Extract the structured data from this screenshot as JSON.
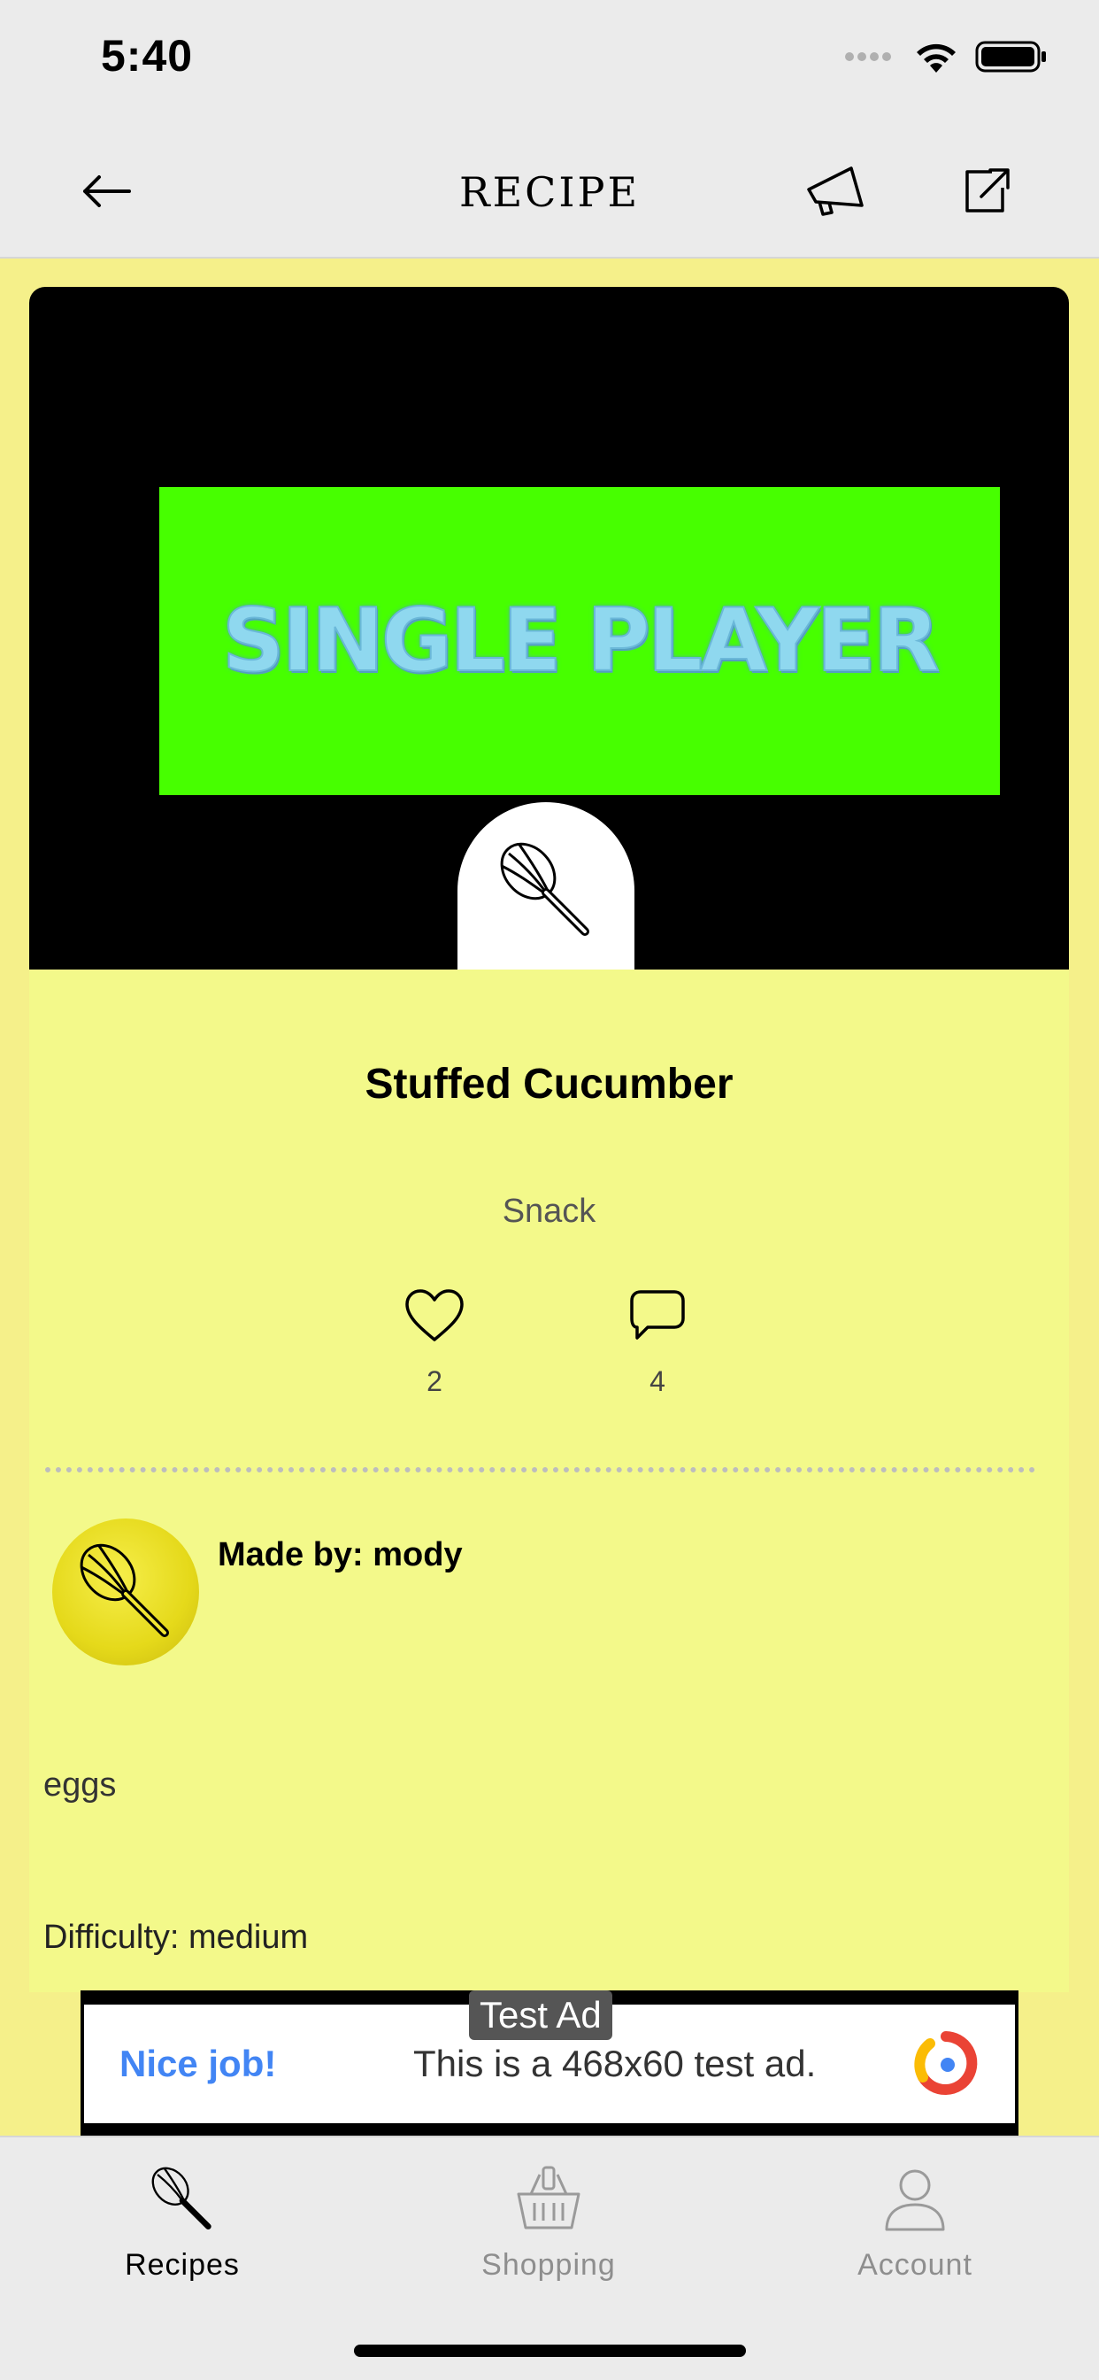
{
  "status_bar": {
    "time": "5:40"
  },
  "nav": {
    "title": "RECIPE",
    "back_icon": "arrow-left-icon",
    "promote_icon": "megaphone-icon",
    "share_icon": "share-icon"
  },
  "media": {
    "banner_text": "SINGLE PLAYER",
    "overlay_icon": "whisk-icon"
  },
  "recipe": {
    "name": "Stuffed Cucumber",
    "category": "Snack",
    "likes": "2",
    "comments": "4",
    "author_label": "Made by: mody",
    "ingredients": "eggs",
    "difficulty": "Difficulty: medium"
  },
  "ad": {
    "badge": "Test Ad",
    "headline": "Nice job!",
    "body": "This is a 468x60 test ad."
  },
  "tabs": [
    {
      "label": "Recipes",
      "icon": "whisk-icon",
      "active": true
    },
    {
      "label": "Shopping",
      "icon": "basket-icon",
      "active": false
    },
    {
      "label": "Account",
      "icon": "user-icon",
      "active": false
    }
  ],
  "colors": {
    "background": "#f5f08a",
    "card": "#f3f98a",
    "banner": "#47ff00",
    "ad_accent": "#4285f4",
    "inactive_tab": "#8e8e8e"
  }
}
